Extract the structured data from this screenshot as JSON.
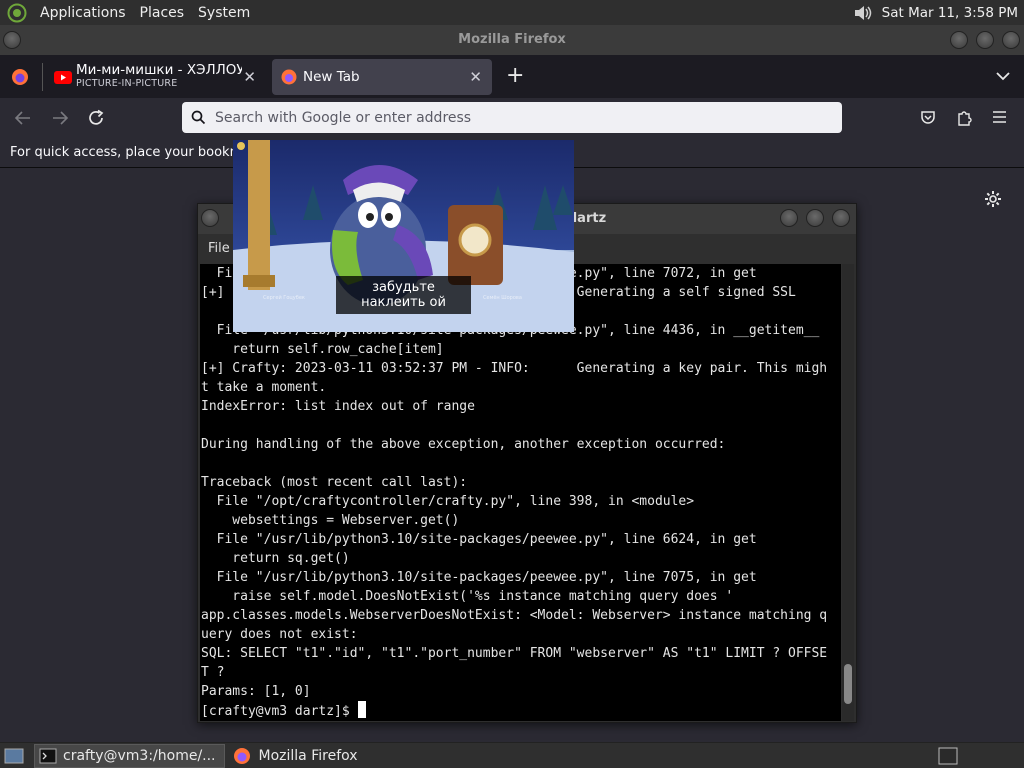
{
  "top_panel": {
    "menus": [
      "Applications",
      "Places",
      "System"
    ],
    "clock": "Sat Mar 11,  3:58 PM"
  },
  "firefox": {
    "window_title": "Mozilla Firefox",
    "tabs": [
      {
        "label": "Ми-ми-мишки - ХЭЛЛОУИН",
        "sub": "PICTURE-IN-PICTURE",
        "icon": "youtube-icon"
      },
      {
        "label": "New Tab",
        "icon": "firefox-icon"
      }
    ],
    "url_placeholder": "Search with Google or enter address",
    "bookmarks_hint": "For quick access, place your bookmarks"
  },
  "pip": {
    "caption": "забудьте наклеить ой",
    "credit_left": "Сергей Гоцубек",
    "credit_right": "Семён Шорова"
  },
  "terminal": {
    "title": "dartz",
    "menu_file": "File",
    "lines": [
      "  File \"/usr/lib/python3.10/site-packages/peewee.py\", line 7072, in get",
      "[+] Crafty: 2023-03-11 03:52:37 PM - INFO:      Generating a self signed SSL",
      "",
      "  File \"/usr/lib/python3.10/site-packages/peewee.py\", line 4436, in __getitem__",
      "    return self.row_cache[item]",
      "[+] Crafty: 2023-03-11 03:52:37 PM - INFO:      Generating a key pair. This migh",
      "t take a moment.",
      "IndexError: list index out of range",
      "",
      "During handling of the above exception, another exception occurred:",
      "",
      "Traceback (most recent call last):",
      "  File \"/opt/craftycontroller/crafty.py\", line 398, in <module>",
      "    websettings = Webserver.get()",
      "  File \"/usr/lib/python3.10/site-packages/peewee.py\", line 6624, in get",
      "    return sq.get()",
      "  File \"/usr/lib/python3.10/site-packages/peewee.py\", line 7075, in get",
      "    raise self.model.DoesNotExist('%s instance matching query does '",
      "app.classes.models.WebserverDoesNotExist: <Model: Webserver> instance matching q",
      "uery does not exist:",
      "SQL: SELECT \"t1\".\"id\", \"t1\".\"port_number\" FROM \"webserver\" AS \"t1\" LIMIT ? OFFSE",
      "T ?",
      "Params: [1, 0]"
    ],
    "prompt": "[crafty@vm3 dartz]$ "
  },
  "taskbar": {
    "items": [
      {
        "label": "crafty@vm3:/home/...",
        "icon": "terminal-icon"
      },
      {
        "label": "Mozilla Firefox",
        "icon": "firefox-icon"
      }
    ]
  }
}
